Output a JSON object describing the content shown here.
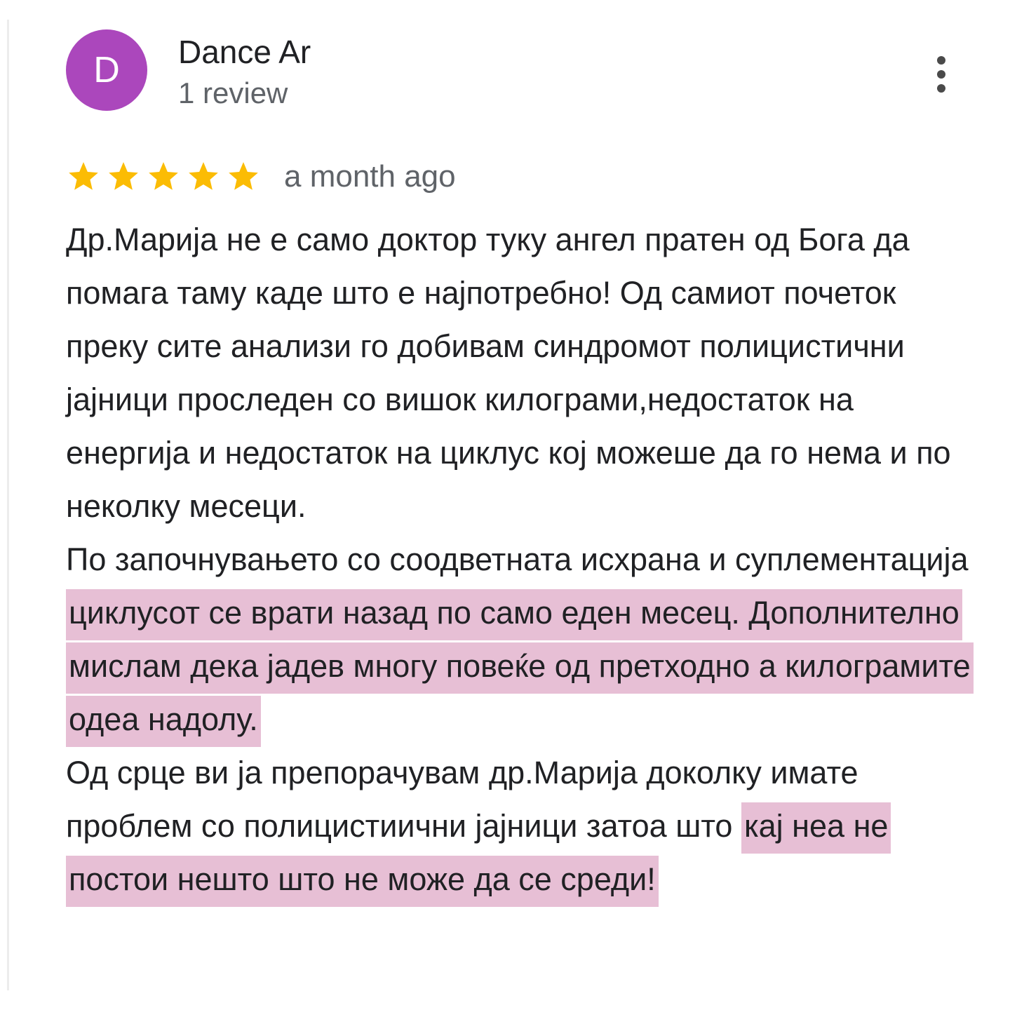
{
  "reviewer": {
    "avatar_letter": "D",
    "avatar_color": "#ab47bc",
    "name": "Dance Ar",
    "review_count": "1 review"
  },
  "menu": {
    "icon": "more-vert-icon"
  },
  "rating": {
    "stars": 5,
    "max_stars": 5,
    "star_color": "#fbbc04",
    "time": "a month ago"
  },
  "highlight_color": "#e7bfd5",
  "review": {
    "p1": "Др.Марија не е само доктор туку ангел пратен од Бога да помага таму каде што е најпотребно! Од самиот почеток преку сите анализи го добивам синдромот полицистични јајници проследен со вишок килограми,недостаток на енергија и недостаток на циклус кој можеше да го нема и по неколку месеци.",
    "p2_plain": "По започнувањето со соодветната исхрана и суплементација ",
    "p2_highlight": "циклусот се врати назад по само еден месец. Дополнително мислам дека јадев многу повеќе од претходно а килограмите одеа надолу.",
    "p3_plain": "Од срце ви ја препорачувам др.Марија доколку имате проблем со полицистиични јајници затоа што ",
    "p3_highlight": "кај неа не постои нешто што не може да се среди!"
  }
}
